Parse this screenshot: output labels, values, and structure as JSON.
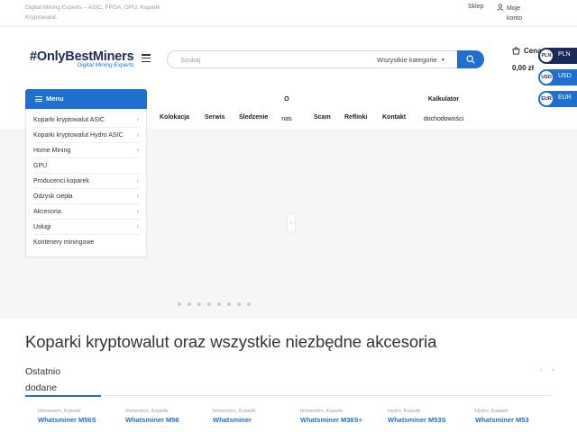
{
  "topbar": {
    "tagline": "Digital Mining Experts – ASIC, FPGA, GPU, Koparki Kryptowalut.",
    "shop_link": "Sklep",
    "account_link": "Moje konto"
  },
  "header": {
    "logo_main": "#OnlyBestMiners",
    "logo_sub": "Digital Mining Experts",
    "search_placeholder": "Szukaj",
    "search_category": "Wszystkie kategorie",
    "cart_label": "Cena",
    "cart_total": "0,00 zł"
  },
  "currencies": [
    {
      "code": "PLN",
      "label": "PLN"
    },
    {
      "code": "USD",
      "label": "USD"
    },
    {
      "code": "EUR",
      "label": "EUR"
    }
  ],
  "menu": {
    "label": "Menu",
    "items": [
      {
        "label": "Koparki kryptowalut ASIC",
        "has_children": true
      },
      {
        "label": "Koparki kryptowalut Hydro ASIC",
        "has_children": true
      },
      {
        "label": "Home Mining",
        "has_children": true
      },
      {
        "label": "GPU",
        "has_children": false
      },
      {
        "label": "Producenci koparek",
        "has_children": true
      },
      {
        "label": "Odzysk ciepła",
        "has_children": true
      },
      {
        "label": "Akcesoria",
        "has_children": true
      },
      {
        "label": "Usługi",
        "has_children": true
      },
      {
        "label": "Kontenery miningowe",
        "has_children": false
      }
    ]
  },
  "nav": {
    "items": [
      "Kolokacja",
      "Serwis",
      "Śledzenie",
      "O nas",
      "Scam",
      "Reflinki",
      "Kontakt",
      "Kalkulator dochodowości"
    ],
    "about_top": "O",
    "about_bottom": "nas",
    "calc_top": "Kalkulator",
    "calc_bottom": "dochodowości"
  },
  "hero": {
    "slide_count": 8,
    "arrow": "‹"
  },
  "main_title": "Koparki kryptowalut oraz wszystkie niezbędne akcesoria",
  "recent": {
    "title_line1": "Ostatnio",
    "title_line2": "dodane",
    "arrows": "‹ ›"
  },
  "products": [
    {
      "category": "Immersion, Koparki",
      "name": "Whatsminer M56S"
    },
    {
      "category": "Immersion, Koparki",
      "name": "Whatsminer M56"
    },
    {
      "category": "Immersion, Koparki",
      "name": "Whatsminer"
    },
    {
      "category": "Immersion, Koparki",
      "name": "Whatsminer M36S+"
    },
    {
      "category": "Hydro, Koparki",
      "name": "Whatsminer M53S"
    },
    {
      "category": "Hydro, Koparki",
      "name": "Whatsminer M53"
    }
  ],
  "colors": {
    "accent": "#1e6fd0",
    "dark": "#1b2a5a"
  }
}
